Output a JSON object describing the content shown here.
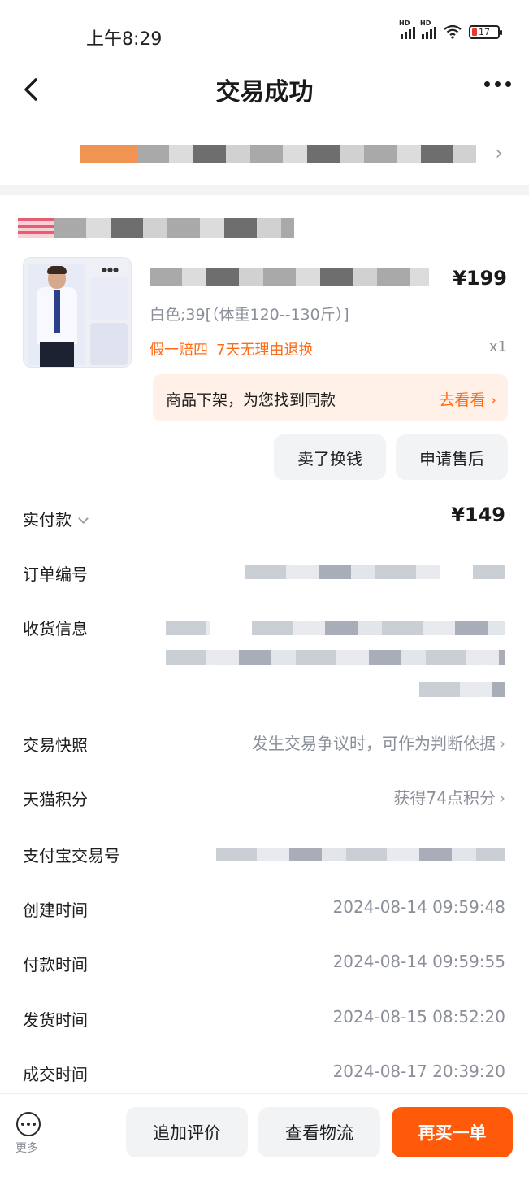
{
  "status_bar": {
    "time": "上午8:29",
    "network": "HD",
    "battery": "17"
  },
  "nav": {
    "title": "交易成功"
  },
  "product": {
    "price": "¥199",
    "sku": "白色;39[（体重120--130斤）]",
    "promos": [
      "假一赔四",
      "7天无理由退换"
    ],
    "quantity": "x1"
  },
  "similar": {
    "text": "商品下架，为您找到同款",
    "link": "去看看 ›"
  },
  "actions": {
    "sell": "卖了换钱",
    "after_sale": "申请售后"
  },
  "order": {
    "paid_label": "实付款",
    "paid_value": "¥149",
    "order_no_label": "订单编号",
    "shipping_label": "收货信息",
    "snapshot_label": "交易快照",
    "snapshot_value": "发生交易争议时，可作为判断依据",
    "points_label": "天猫积分",
    "points_value": "获得74点积分",
    "alipay_label": "支付宝交易号",
    "created_label": "创建时间",
    "created_value": "2024-08-14 09:59:48",
    "paid_time_label": "付款时间",
    "paid_time_value": "2024-08-14 09:59:55",
    "shipped_label": "发货时间",
    "shipped_value": "2024-08-15 08:52:20",
    "deal_label": "成交时间",
    "deal_value": "2024-08-17 20:39:20"
  },
  "bottom_bar": {
    "more_label": "更多",
    "review": "追加评价",
    "logistics": "查看物流",
    "rebuy": "再买一单"
  },
  "colors": {
    "accent": "#ff5a0a",
    "link_orange": "#ff6a14",
    "muted": "#8a8f99"
  }
}
